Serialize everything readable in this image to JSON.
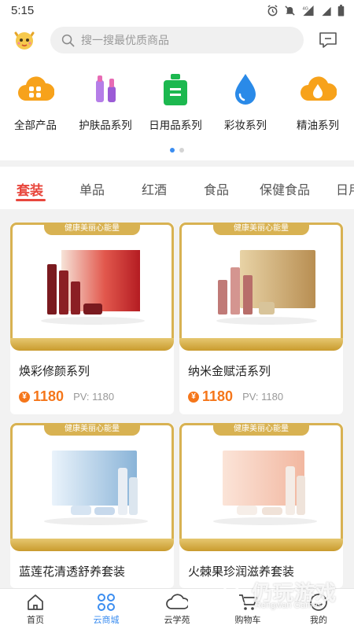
{
  "status": {
    "time": "5:15"
  },
  "search": {
    "placeholder": "搜一搜最优质商品"
  },
  "categories": [
    {
      "label": "全部产品",
      "icon": "grid-cloud-icon",
      "color": "#f7a21b"
    },
    {
      "label": "护肤品系列",
      "icon": "lipstick-icon",
      "color": "#9b5bd6"
    },
    {
      "label": "日用品系列",
      "icon": "bottle-icon",
      "color": "#1cb84f"
    },
    {
      "label": "彩妆系列",
      "icon": "water-drop-icon",
      "color": "#2a8ae8"
    },
    {
      "label": "精油系列",
      "icon": "oil-drop-cloud-icon",
      "color": "#f7a21b"
    }
  ],
  "tabs": [
    "套装",
    "单品",
    "红酒",
    "食品",
    "保健食品",
    "日用"
  ],
  "products": [
    {
      "banner": "健康美丽心能量",
      "name": "焕彩修颜系列",
      "price": "1180",
      "pv": "PV: 1180",
      "box_color": "#c8292e"
    },
    {
      "banner": "健康美丽心能量",
      "name": "纳米金赋活系列",
      "price": "1180",
      "pv": "PV: 1180",
      "box_color": "#c9a769"
    },
    {
      "banner": "健康美丽心能量",
      "name": "蓝莲花清透舒养套装",
      "price": "",
      "pv": "",
      "box_color": "#8ab4d8"
    },
    {
      "banner": "健康美丽心能量",
      "name": "火棘果珍润滋养套装",
      "price": "",
      "pv": "",
      "box_color": "#f2b7a0"
    }
  ],
  "coin_symbol": "¥",
  "nav": [
    {
      "label": "首页",
      "icon": "home-icon"
    },
    {
      "label": "云商城",
      "icon": "store-grid-icon"
    },
    {
      "label": "云学苑",
      "icon": "cloud-icon"
    },
    {
      "label": "购物车",
      "icon": "cart-icon"
    },
    {
      "label": "我的",
      "icon": "user-smile-icon"
    }
  ],
  "watermark": {
    "title": "仍玩游戏",
    "subtitle": "Rengwan Games"
  },
  "colors": {
    "accent": "#3b8df0",
    "tab_active": "#e8473d",
    "price": "#f5761a",
    "gold": "#d8b252"
  }
}
